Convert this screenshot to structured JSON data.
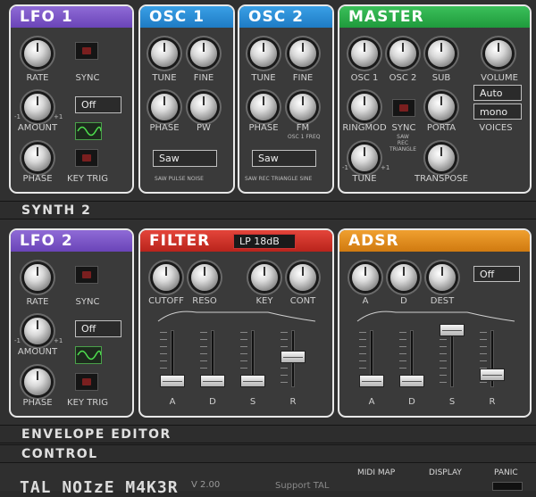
{
  "synth2_label": "SYNTH 2",
  "envelope_label": "ENVELOPE EDITOR",
  "control_label": "CONTROL",
  "lfo1": {
    "title": "LFO 1",
    "rate": "RATE",
    "sync": "SYNC",
    "amount": "AMOUNT",
    "amount_value": "Off",
    "phase": "PHASE",
    "key_trig": "KEY TRIG",
    "minus": "-1",
    "plus": "+1"
  },
  "osc1": {
    "title": "OSC 1",
    "tune": "TUNE",
    "fine": "FINE",
    "phase": "PHASE",
    "pw": "PW",
    "wave_value": "Saw",
    "waves": "SAW  PULSE  NOISE"
  },
  "osc2": {
    "title": "OSC 2",
    "tune": "TUNE",
    "fine": "FINE",
    "phase": "PHASE",
    "fm": "FM",
    "fm_sub": "OSC 1 FREQ",
    "wave_value": "Saw",
    "waves": "SAW  REC  TRIANGLE  SINE"
  },
  "master": {
    "title": "MASTER",
    "osc1": "OSC 1",
    "osc2": "OSC 2",
    "sub": "SUB",
    "volume": "VOLUME",
    "ringmod": "RINGMOD",
    "sync": "SYNC",
    "sync_sub": "SAW\nREC\nTRIANGLE",
    "porta": "PORTA",
    "porta_mode": "Auto",
    "voices_mode": "mono",
    "voices": "VOICES",
    "tune": "TUNE",
    "transpose": "TRANSPOSE",
    "minus": "-1",
    "plus": "+1"
  },
  "lfo2": {
    "title": "LFO 2",
    "rate": "RATE",
    "sync": "SYNC",
    "amount": "AMOUNT",
    "amount_value": "Off",
    "phase": "PHASE",
    "key_trig": "KEY TRIG",
    "minus": "-1",
    "plus": "+1"
  },
  "filter": {
    "title": "FILTER",
    "type": "LP 18dB",
    "cutoff": "CUTOFF",
    "reso": "RESO",
    "key": "KEY",
    "cont": "CONT",
    "a": "A",
    "d": "D",
    "s": "S",
    "r": "R",
    "levels": {
      "a": 0.0,
      "d": 0.0,
      "s": 0.0,
      "r": 0.48
    }
  },
  "adsr": {
    "title": "ADSR",
    "a": "A",
    "d": "D",
    "dest": "DEST",
    "dest_value": "Off",
    "sa": "A",
    "sd": "D",
    "ss": "S",
    "sr": "R",
    "levels": {
      "a": 0.0,
      "d": 0.0,
      "s": 1.0,
      "r": 0.12
    }
  },
  "footer": {
    "logo": "TAL NOIzE M4K3R",
    "version": "V 2.00",
    "support": "Support TAL",
    "midi_map": "MIDI MAP",
    "display": "DISPLAY",
    "panic": "PANIC"
  }
}
